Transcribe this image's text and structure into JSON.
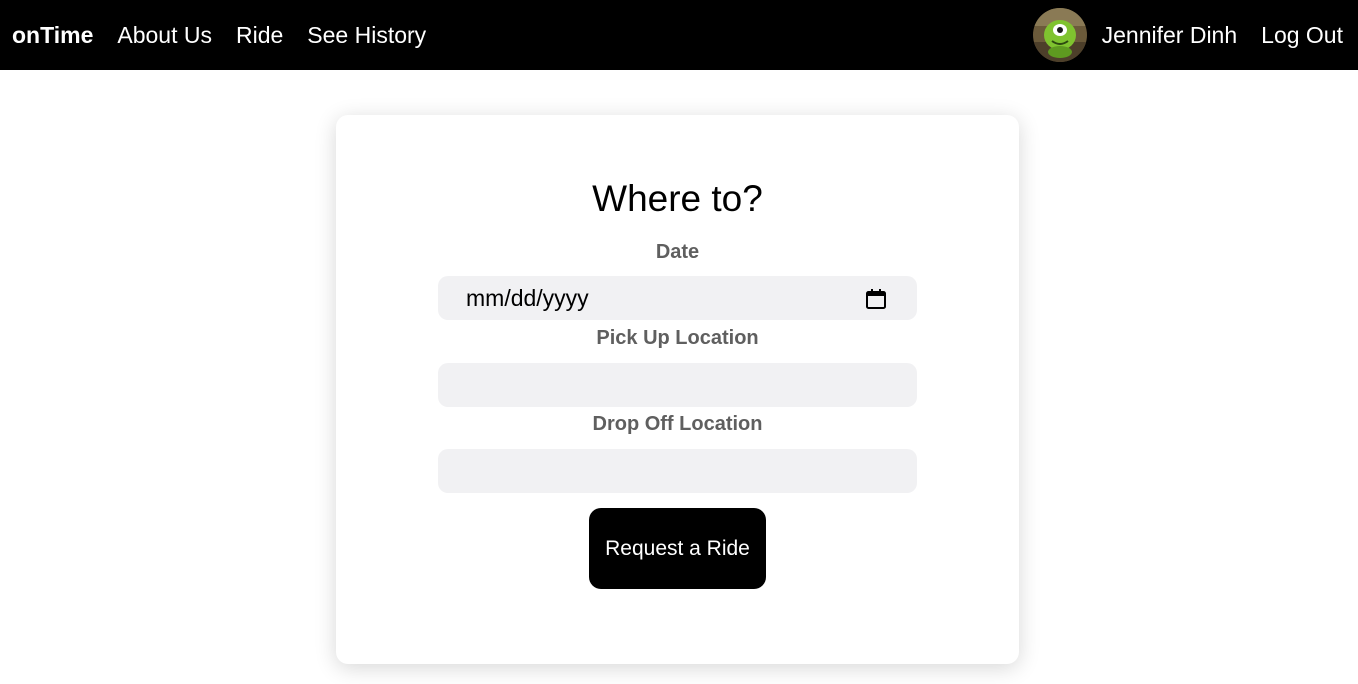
{
  "nav": {
    "brand": "onTime",
    "links": [
      "About Us",
      "Ride",
      "See History"
    ],
    "user_name": "Jennifer Dinh",
    "logout_label": "Log Out"
  },
  "form": {
    "title": "Where to?",
    "date_label": "Date",
    "date_placeholder": "mm/dd/yyyy",
    "pickup_label": "Pick Up Location",
    "pickup_value": "",
    "dropoff_label": "Drop Off Location",
    "dropoff_value": "",
    "submit_label": "Request a Ride"
  },
  "colors": {
    "navbar_bg": "#000000",
    "field_bg": "#f1f1f3",
    "label_text": "#5f5f5f",
    "button_bg": "#000000"
  },
  "icons": {
    "avatar": "user-avatar-image",
    "date_picker": "calendar-icon"
  }
}
